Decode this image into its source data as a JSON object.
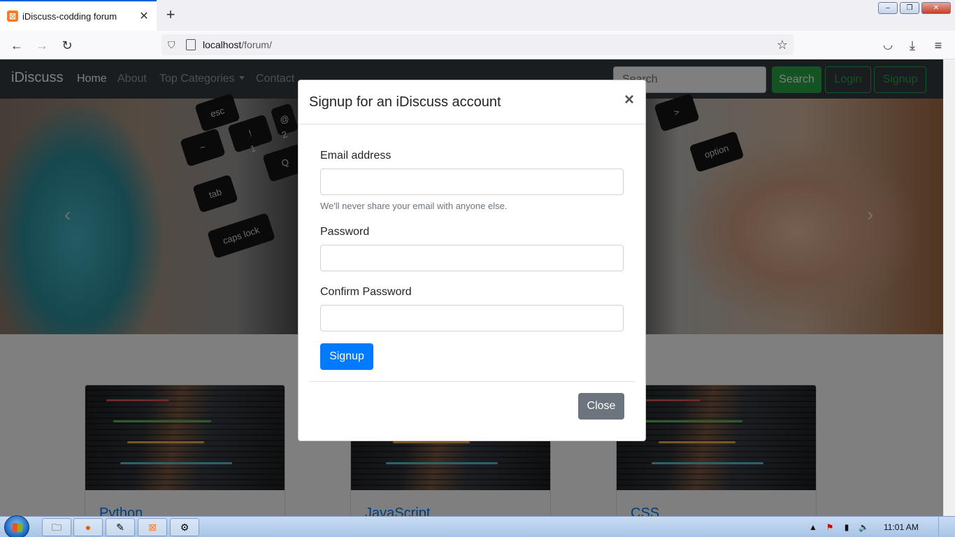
{
  "browser": {
    "tab_title": "iDiscuss-codding forum",
    "tab_close": "✕",
    "new_tab": "+",
    "url_host": "localhost",
    "url_path": "/forum/",
    "window_controls": {
      "minimize": "–",
      "restore": "❐",
      "close": "✕"
    }
  },
  "site": {
    "brand": "iDiscuss",
    "nav": [
      "Home",
      "About",
      "Top Categories",
      "Contact"
    ],
    "search_placeholder": "Search",
    "search_button": "Search",
    "login_button": "Login",
    "signup_button": "Signup"
  },
  "hero": {
    "keys": [
      "esc",
      "~",
      "!",
      "1",
      "Q",
      "tab",
      "caps lock",
      "@",
      "2",
      ">",
      "option"
    ],
    "prev": "‹",
    "next": "›"
  },
  "categories": [
    "Python",
    "JavaScript",
    "CSS"
  ],
  "modal": {
    "title": "Signup for an iDiscuss account",
    "close_x": "×",
    "email_label": "Email address",
    "email_help": "We'll never share your email with anyone else.",
    "password_label": "Password",
    "confirm_label": "Confirm Password",
    "submit": "Signup",
    "close": "Close"
  },
  "taskbar": {
    "time": "11:01 AM",
    "items": [
      "explorer-icon",
      "firefox-icon",
      "notepad-icon",
      "xampp-icon",
      "tool-icon"
    ]
  },
  "colors": {
    "navbar": "#343a40",
    "primary": "#007bff",
    "success": "#28a745",
    "secondary": "#6c757d"
  }
}
